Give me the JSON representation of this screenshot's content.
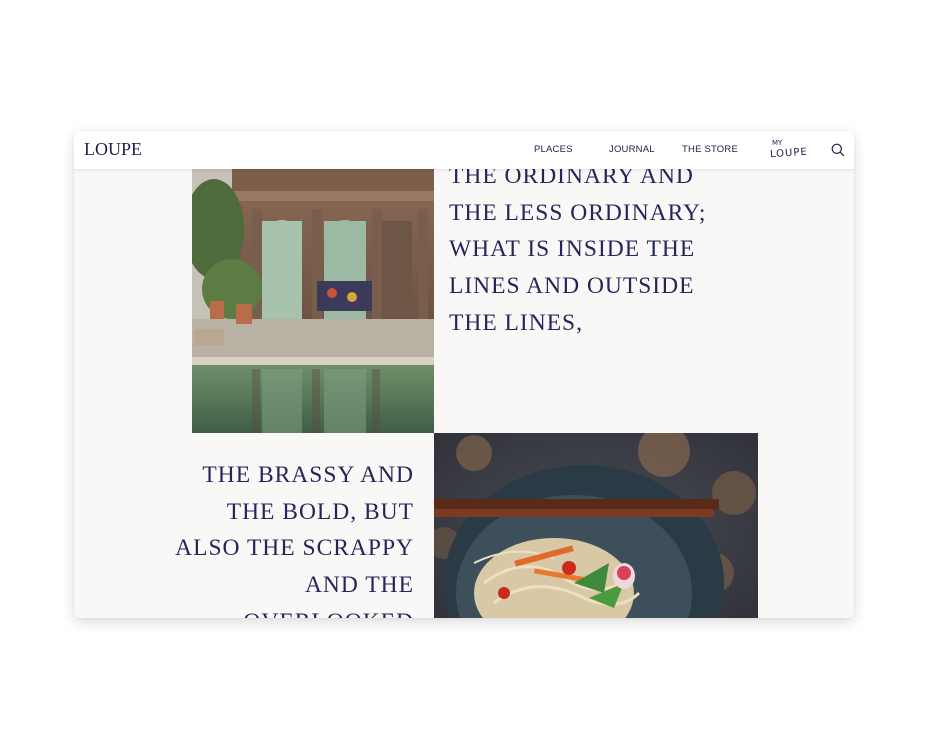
{
  "header": {
    "logo": "LOUPE",
    "nav": {
      "places": "PLACES",
      "journal": "JOURNAL",
      "store": "THE STORE"
    },
    "my_loupe": {
      "my": "MY",
      "loupe": "LOUPE"
    },
    "search_icon": "search-icon"
  },
  "content": {
    "text_right": "THE ORDINARY AND THE LESS ORDINARY; WHAT IS INSIDE THE LINES  AND OUTSIDE THE LINES,",
    "text_left": "THE BRASSY AND THE BOLD, BUT ALSO THE SCRAPPY AND THE OVERLOOKED"
  },
  "colors": {
    "brand_navy": "#24265a",
    "background": "#faf8f7"
  }
}
